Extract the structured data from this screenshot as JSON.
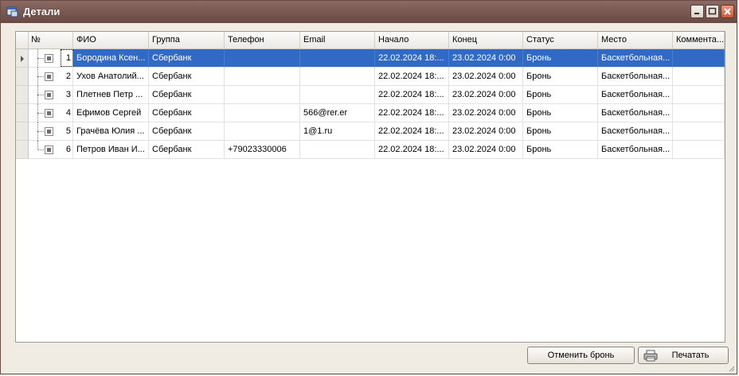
{
  "window": {
    "title": "Детали"
  },
  "icons": {
    "app": "app-window-icon",
    "minimize": "minimize-icon",
    "maximize": "maximize-icon",
    "close": "close-icon",
    "print": "printer-icon",
    "current_row": "row-pointer-icon"
  },
  "grid": {
    "columns": [
      "№",
      "ФИО",
      "Группа",
      "Телефон",
      "Email",
      "Начало",
      "Конец",
      "Статус",
      "Место",
      "Коммента..."
    ],
    "rows": [
      {
        "num": "1",
        "fio": "Бородина Ксен...",
        "group": "Сбербанк",
        "phone": "",
        "email": "",
        "start": "22.02.2024 18:...",
        "end": "23.02.2024 0:00",
        "status": "Бронь",
        "place": "Баскетбольная...",
        "comment": ""
      },
      {
        "num": "2",
        "fio": "Ухов Анатолий...",
        "group": "Сбербанк",
        "phone": "",
        "email": "",
        "start": "22.02.2024 18:...",
        "end": "23.02.2024 0:00",
        "status": "Бронь",
        "place": "Баскетбольная...",
        "comment": ""
      },
      {
        "num": "3",
        "fio": "Плетнев Петр ...",
        "group": "Сбербанк",
        "phone": "",
        "email": "",
        "start": "22.02.2024 18:...",
        "end": "23.02.2024 0:00",
        "status": "Бронь",
        "place": "Баскетбольная...",
        "comment": ""
      },
      {
        "num": "4",
        "fio": "Ефимов Сергей",
        "group": "Сбербанк",
        "phone": "",
        "email": "566@rer.er",
        "start": "22.02.2024 18:...",
        "end": "23.02.2024 0:00",
        "status": "Бронь",
        "place": "Баскетбольная...",
        "comment": ""
      },
      {
        "num": "5",
        "fio": "Грачёва Юлия ...",
        "group": "Сбербанк",
        "phone": "",
        "email": "1@1.ru",
        "start": "22.02.2024 18:...",
        "end": "23.02.2024 0:00",
        "status": "Бронь",
        "place": "Баскетбольная...",
        "comment": ""
      },
      {
        "num": "6",
        "fio": "Петров Иван И...",
        "group": "Сбербанк",
        "phone": "+79023330006",
        "email": "",
        "start": "22.02.2024 18:...",
        "end": "23.02.2024 0:00",
        "status": "Бронь",
        "place": "Баскетбольная...",
        "comment": ""
      }
    ],
    "selected_row": 0
  },
  "buttons": {
    "cancel_booking": "Отменить бронь",
    "print": "Печатать"
  },
  "colors": {
    "selection": "#316ac5",
    "titlebar": "#7a5a52",
    "window_bg": "#f0ece4"
  }
}
